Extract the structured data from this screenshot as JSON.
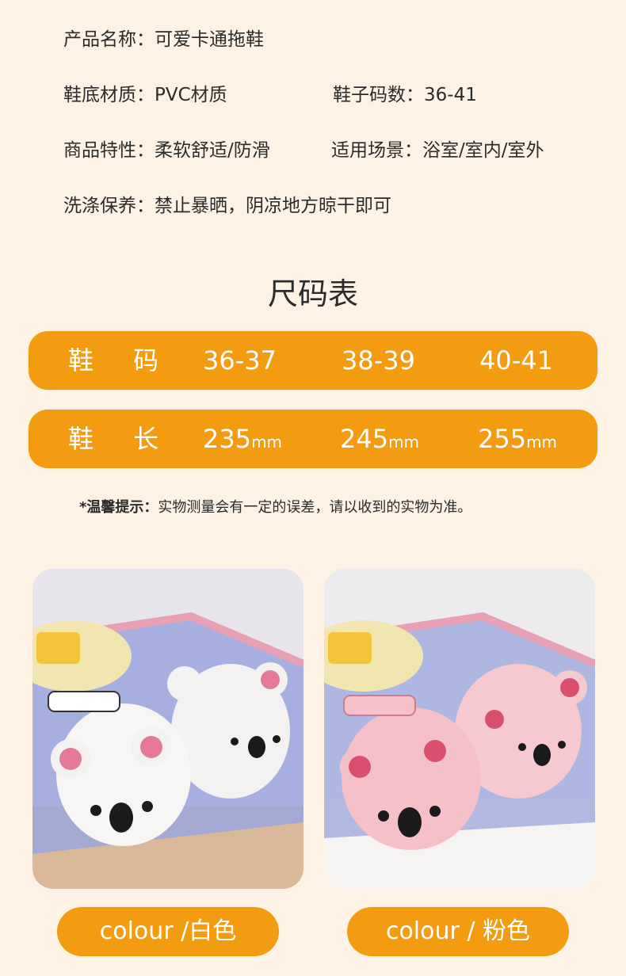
{
  "specs": {
    "name": {
      "label": "产品名称：",
      "value": "可爱卡通拖鞋"
    },
    "sole": {
      "label": "鞋底材质：",
      "value": "PVC材质"
    },
    "size_range": {
      "label": "鞋子码数：",
      "value": "36-41"
    },
    "feature": {
      "label": "商品特性：",
      "value": "柔软舒适/防滑"
    },
    "scene": {
      "label": "适用场景：",
      "value": "浴室/室内/室外"
    },
    "care": {
      "label": "洗涤保养：",
      "value": "禁止暴晒，阴凉地方晾干即可"
    }
  },
  "size_chart": {
    "title": "尺码表",
    "size_row": {
      "label": "鞋 码",
      "values": [
        "36-37",
        "38-39",
        "40-41"
      ]
    },
    "length_row": {
      "label": "鞋 长",
      "values": [
        "235",
        "245",
        "255"
      ],
      "unit": "mm"
    }
  },
  "notice": {
    "prefix": "*温馨提示：",
    "text": "实物测量会有一定的误差，请以收到的实物为准。"
  },
  "colours": [
    {
      "label": "colour /白色",
      "icon": "koala-slipper-white-photo"
    },
    {
      "label": "colour / 粉色",
      "icon": "koala-slipper-pink-photo"
    }
  ],
  "colors": {
    "accent": "#f39c12",
    "background": "#fdf2e3",
    "text": "#2b2b2b"
  }
}
